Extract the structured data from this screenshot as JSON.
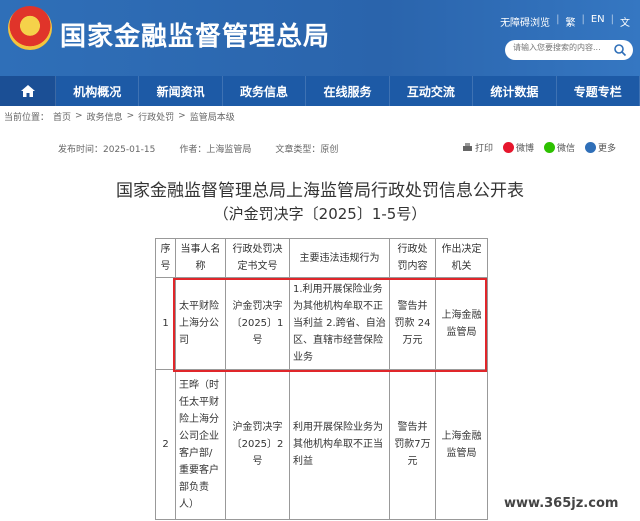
{
  "header": {
    "site_title": "国家金融监督管理总局",
    "top_links": [
      "无障碍浏览",
      "繁",
      "EN",
      "文"
    ],
    "search_placeholder": "请输入您要搜索的内容..."
  },
  "nav": {
    "items": [
      "机构概况",
      "新闻资讯",
      "政务信息",
      "在线服务",
      "互动交流",
      "统计数据",
      "专题专栏"
    ]
  },
  "breadcrumb": {
    "label": "当前位置：",
    "items": [
      "首页",
      "政务信息",
      "行政处罚",
      "监管局本级"
    ]
  },
  "meta": {
    "date": "发布时间：2025-01-15",
    "source": "作者：上海监管局",
    "doctype": "文章类型：原创"
  },
  "share": {
    "print": "打印",
    "weibo": "微博",
    "wechat": "微信",
    "more": "更多"
  },
  "document": {
    "title": "国家金融监督管理总局上海监管局行政处罚信息公开表",
    "subtitle": "（沪金罚决字〔2025〕1-5号）"
  },
  "table": {
    "headers": [
      "序号",
      "当事人名称",
      "行政处罚决定书文号",
      "主要违法违规行为",
      "行政处罚内容",
      "作出决定机关"
    ],
    "rows": [
      {
        "no": "1",
        "party": "太平财险上海分公司",
        "doc_no": "沪金罚决字〔2025〕1号",
        "violation": "1.利用开展保险业务为其他机构牟取不正当利益 2.跨省、自治区、直辖市经营保险业务",
        "penalty": "警告并罚款 24 万元",
        "authority": "上海金融监管局"
      },
      {
        "no": "2",
        "party": "王晔（时任太平财险上海分公司企业客户部/重要客户部负责人）",
        "doc_no": "沪金罚决字〔2025〕2号",
        "violation": "利用开展保险业务为其他机构牟取不正当利益",
        "penalty": "警告并罚款7万元",
        "authority": "上海金融监管局"
      }
    ]
  },
  "watermark": "www.365jz.com"
}
